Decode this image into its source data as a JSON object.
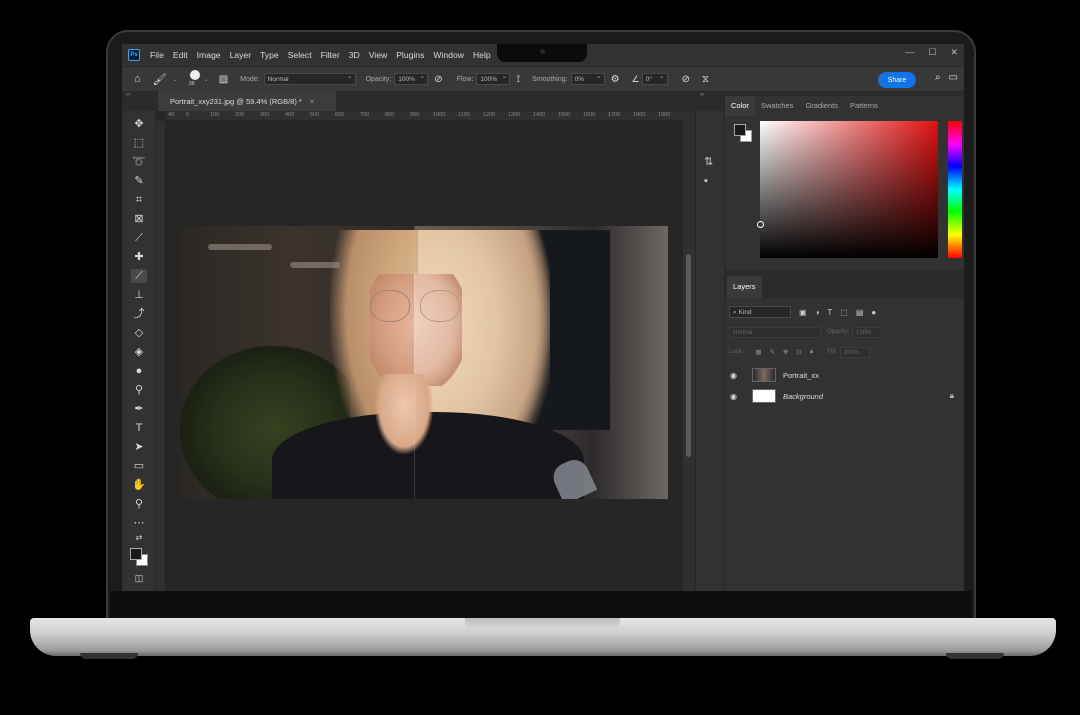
{
  "app": {
    "logo": "Ps",
    "menu": [
      "File",
      "Edit",
      "Image",
      "Layer",
      "Type",
      "Select",
      "Filter",
      "3D",
      "View",
      "Plugins",
      "Window",
      "Help"
    ],
    "window_controls": [
      "—",
      "☐",
      "✕"
    ]
  },
  "options": {
    "brush_size": "36",
    "mode_label": "Mode:",
    "mode_value": "Normal",
    "opacity_label": "Opacity:",
    "opacity_value": "100%",
    "flow_label": "Flow:",
    "flow_value": "100%",
    "smoothing_label": "Smoothing:",
    "smoothing_value": "0%",
    "angle_value": "0°",
    "share_label": "Share"
  },
  "document": {
    "tab_title": "Portrait_xxy231.jpg @ 59.4% (RGB/8) *",
    "close": "×",
    "ruler_ticks": [
      "40",
      "0",
      "100",
      "200",
      "300",
      "400",
      "500",
      "600",
      "700",
      "800",
      "900",
      "1000",
      "1100",
      "1200",
      "1300",
      "1400",
      "1500",
      "1600",
      "1700",
      "1800",
      "1900"
    ]
  },
  "color_panel": {
    "tabs": [
      "Color",
      "Swatches",
      "Gradients",
      "Patterns"
    ],
    "active_tab": "Color",
    "hue_color": "#e01010"
  },
  "layers_panel": {
    "tab": "Layers",
    "kind_label": "Kind",
    "blend_mode": "Normal",
    "opacity_label": "Opacity:",
    "opacity_value": "100%",
    "lock_label": "Lock:",
    "fill_label": "Fill:",
    "fill_value": "100%",
    "layers": [
      {
        "name": "Portrait_xx",
        "visible": true
      },
      {
        "name": "Background",
        "visible": true,
        "locked": true
      }
    ]
  }
}
